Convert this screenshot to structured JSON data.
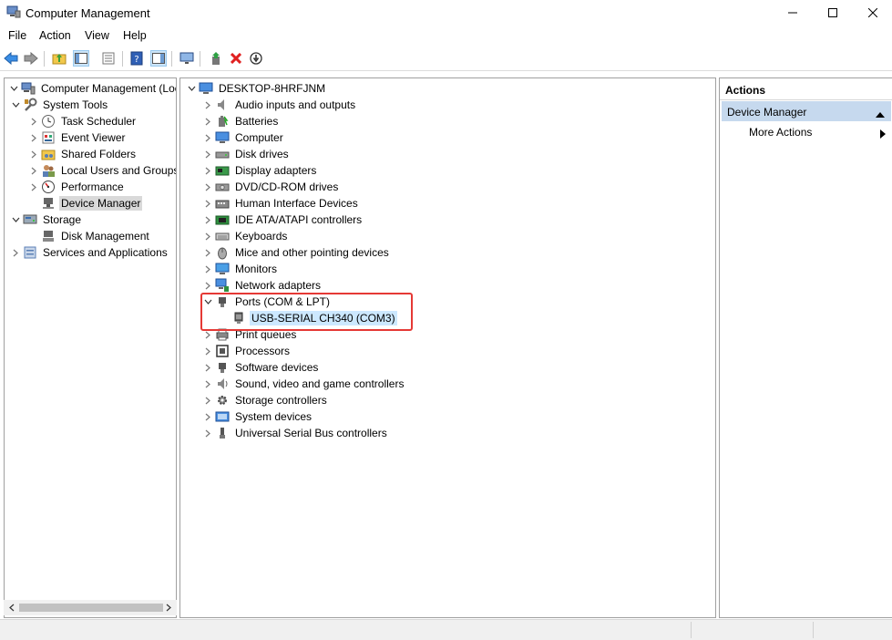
{
  "window": {
    "title": "Computer Management"
  },
  "menu": [
    "File",
    "Action",
    "View",
    "Help"
  ],
  "left_tree": [
    {
      "label": "Computer Management (Local",
      "chev": "down",
      "level": 0,
      "icon": "computer-management-icon"
    },
    {
      "label": "System Tools",
      "chev": "down",
      "level": 1,
      "icon": "system-tools-icon"
    },
    {
      "label": "Task Scheduler",
      "chev": "right",
      "level": 2,
      "icon": "task-scheduler-icon"
    },
    {
      "label": "Event Viewer",
      "chev": "right",
      "level": 2,
      "icon": "event-viewer-icon"
    },
    {
      "label": "Shared Folders",
      "chev": "right",
      "level": 2,
      "icon": "shared-folders-icon"
    },
    {
      "label": "Local Users and Groups",
      "chev": "right",
      "level": 2,
      "icon": "local-users-icon"
    },
    {
      "label": "Performance",
      "chev": "right",
      "level": 2,
      "icon": "performance-icon"
    },
    {
      "label": "Device Manager",
      "chev": "none",
      "level": 2,
      "icon": "device-manager-icon",
      "selected": true
    },
    {
      "label": "Storage",
      "chev": "down",
      "level": 1,
      "icon": "storage-icon"
    },
    {
      "label": "Disk Management",
      "chev": "none",
      "level": 2,
      "icon": "disk-management-icon"
    },
    {
      "label": "Services and Applications",
      "chev": "right",
      "level": 1,
      "icon": "services-icon"
    }
  ],
  "device_tree": {
    "root": "DESKTOP-8HRFJNM",
    "categories": [
      {
        "label": "Audio inputs and outputs",
        "icon": "audio-icon"
      },
      {
        "label": "Batteries",
        "icon": "battery-icon"
      },
      {
        "label": "Computer",
        "icon": "computer-icon"
      },
      {
        "label": "Disk drives",
        "icon": "disk-drive-icon"
      },
      {
        "label": "Display adapters",
        "icon": "display-adapter-icon"
      },
      {
        "label": "DVD/CD-ROM drives",
        "icon": "dvd-icon"
      },
      {
        "label": "Human Interface Devices",
        "icon": "hid-icon"
      },
      {
        "label": "IDE ATA/ATAPI controllers",
        "icon": "ide-icon"
      },
      {
        "label": "Keyboards",
        "icon": "keyboard-icon"
      },
      {
        "label": "Mice and other pointing devices",
        "icon": "mouse-icon"
      },
      {
        "label": "Monitors",
        "icon": "monitor-icon"
      },
      {
        "label": "Network adapters",
        "icon": "network-icon"
      },
      {
        "label": "Ports (COM & LPT)",
        "icon": "port-icon",
        "expanded": true,
        "children": [
          {
            "label": "USB-SERIAL CH340 (COM3)",
            "icon": "serial-port-icon"
          }
        ]
      },
      {
        "label": "Print queues",
        "icon": "printer-icon"
      },
      {
        "label": "Processors",
        "icon": "processor-icon"
      },
      {
        "label": "Software devices",
        "icon": "software-device-icon"
      },
      {
        "label": "Sound, video and game controllers",
        "icon": "sound-icon"
      },
      {
        "label": "Storage controllers",
        "icon": "storage-controller-icon"
      },
      {
        "label": "System devices",
        "icon": "system-device-icon"
      },
      {
        "label": "Universal Serial Bus controllers",
        "icon": "usb-icon"
      }
    ]
  },
  "actions": {
    "header": "Actions",
    "section": "Device Manager",
    "items": [
      "More Actions"
    ]
  },
  "colors": {
    "selection": "#cce8ff",
    "highlight_box": "#e53935",
    "action_section": "#c6d9ee"
  }
}
